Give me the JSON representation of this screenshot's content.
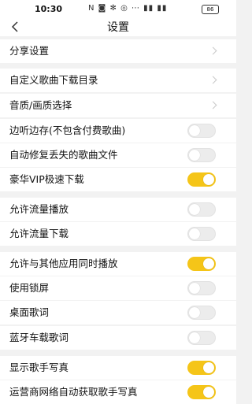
{
  "status_bar": {
    "time": "10:30",
    "icons": "N ◙ ✻ ◎ ⋯ ▮▮ ▮▮",
    "battery": "86"
  },
  "header": {
    "title": "设置"
  },
  "settings": [
    {
      "label": "分享设置",
      "type": "link"
    },
    {
      "label": "自定义歌曲下载目录",
      "type": "link"
    },
    {
      "label": "音质/画质选择",
      "type": "link"
    },
    {
      "label": "边听边存(不包含付费歌曲)",
      "type": "toggle",
      "on": false
    },
    {
      "label": "自动修复丢失的歌曲文件",
      "type": "toggle",
      "on": false
    },
    {
      "label": "豪华VIP极速下载",
      "type": "toggle",
      "on": true
    },
    {
      "label": "允许流量播放",
      "type": "toggle",
      "on": false
    },
    {
      "label": "允许流量下载",
      "type": "toggle",
      "on": false
    },
    {
      "label": "允许与其他应用同时播放",
      "type": "toggle",
      "on": true
    },
    {
      "label": "使用锁屏",
      "type": "toggle",
      "on": false
    },
    {
      "label": "桌面歌词",
      "type": "toggle",
      "on": false
    },
    {
      "label": "蓝牙车载歌词",
      "type": "toggle",
      "on": false
    },
    {
      "label": "显示歌手写真",
      "type": "toggle",
      "on": true
    },
    {
      "label": "运营商网络自动获取歌手写真",
      "type": "toggle",
      "on": true
    }
  ],
  "colors": {
    "toggle_on": "#f5c518",
    "toggle_off": "#ececec"
  }
}
